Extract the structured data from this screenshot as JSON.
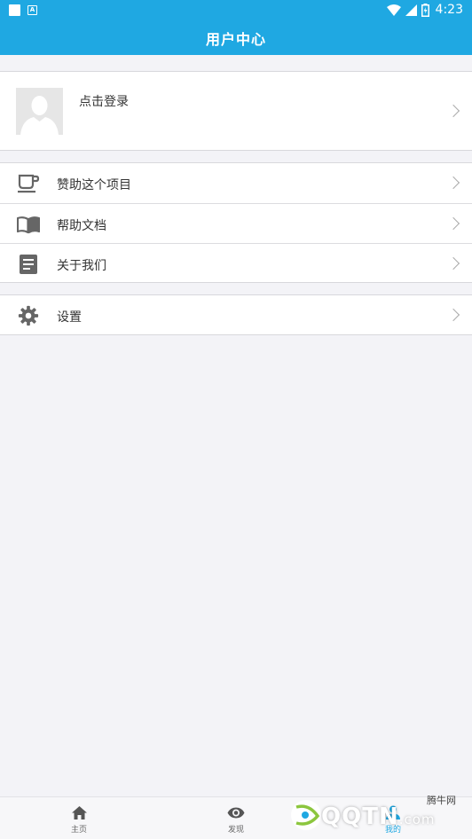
{
  "statusbar": {
    "time": "4:23",
    "notif_icon_letter": "A"
  },
  "appbar": {
    "title": "用户中心"
  },
  "profile": {
    "login_label": "点击登录"
  },
  "menu_group1": [
    {
      "icon": "coffee-cup-icon",
      "label": "赞助这个项目"
    },
    {
      "icon": "book-icon",
      "label": "帮助文档"
    },
    {
      "icon": "document-icon",
      "label": "关于我们"
    }
  ],
  "menu_group2": [
    {
      "icon": "gear-icon",
      "label": "设置"
    }
  ],
  "tabbar": {
    "tabs": [
      {
        "icon": "home-icon",
        "label": "主页"
      },
      {
        "icon": "eye-icon",
        "label": "发现"
      },
      {
        "icon": "person-icon",
        "label": "我的",
        "active": true
      }
    ]
  },
  "watermark": {
    "logo_text": "QQTN",
    "suffix": ".com",
    "site_name": "腾牛网"
  },
  "colors": {
    "primary": "#1fa8e2",
    "background": "#f3f3f7",
    "icon_gray": "#666666"
  }
}
